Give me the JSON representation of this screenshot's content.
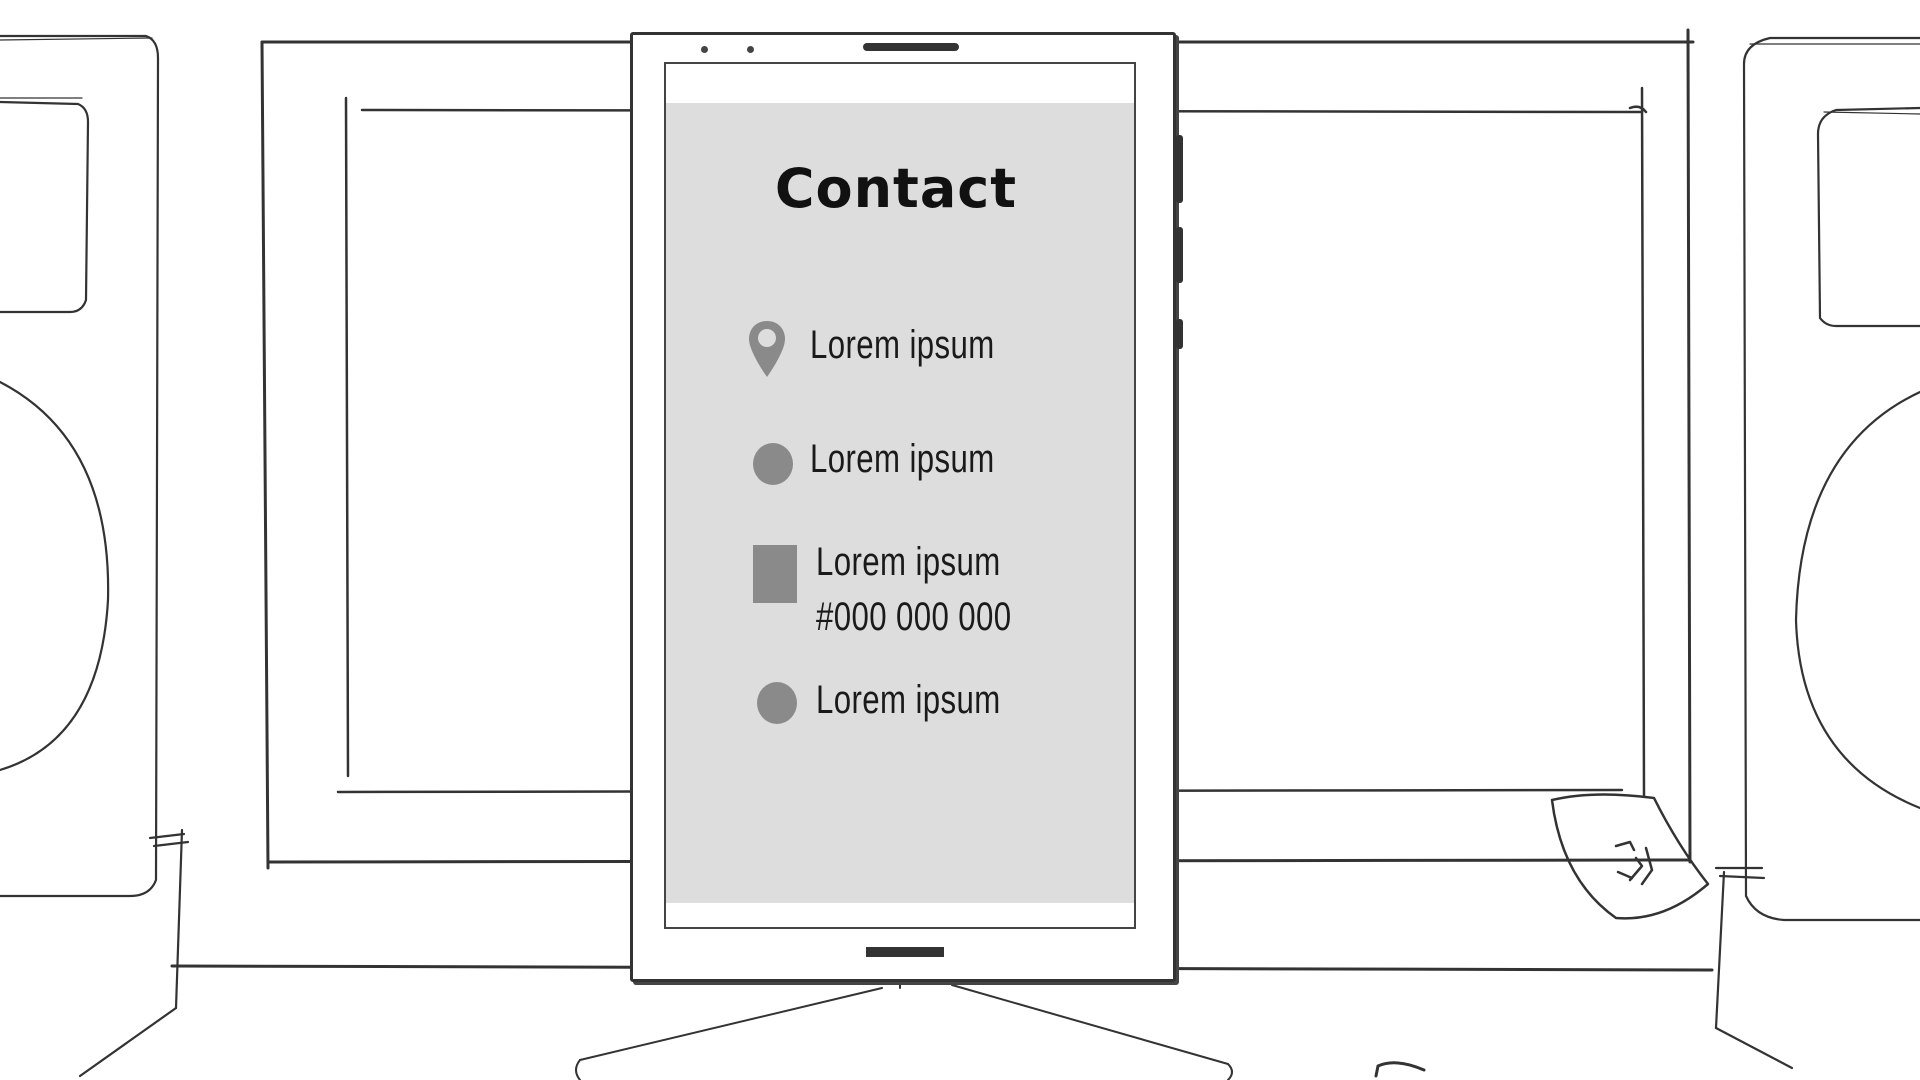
{
  "screen": {
    "title": "Contact",
    "items": [
      {
        "icon": "location-pin-icon",
        "label": "Lorem ipsum"
      },
      {
        "icon": "circle-icon",
        "label": "Lorem ipsum"
      },
      {
        "icon": "phone-icon",
        "label": "Lorem ipsum",
        "detail": "#000 000 000"
      },
      {
        "icon": "circle-icon",
        "label": "Lorem ipsum"
      }
    ]
  },
  "colors": {
    "screen_background": "#dddddd",
    "icon_fill": "#8a8a8a",
    "text": "#1a1a1a",
    "sketch_line": "#333333"
  }
}
